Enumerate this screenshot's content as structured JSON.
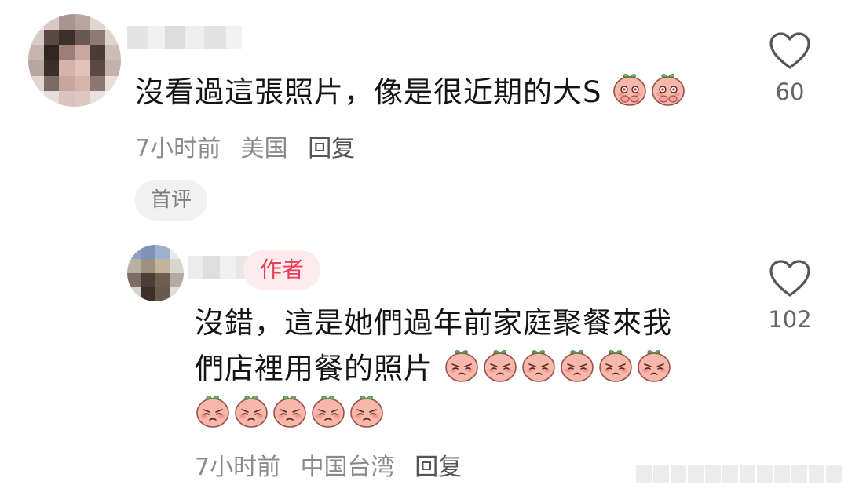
{
  "comments": [
    {
      "text": "沒看過這張照片，像是很近期的大S",
      "emojis": [
        "shy-peach-emoji",
        "shy-peach-emoji"
      ],
      "time": "7小时前",
      "location": "美国",
      "reply_label": "回复",
      "tag": "首评",
      "like_count": "60"
    },
    {
      "badge": "作者",
      "text_line1": "沒錯，這是她們過年前家庭聚餐來我",
      "text_line2": "們店裡用餐的照片",
      "emojis_line2": [
        "sad-peach-emoji",
        "sad-peach-emoji",
        "sad-peach-emoji",
        "sad-peach-emoji",
        "sad-peach-emoji",
        "sad-peach-emoji"
      ],
      "emojis_line3": [
        "sad-peach-emoji",
        "sad-peach-emoji",
        "sad-peach-emoji",
        "sad-peach-emoji",
        "sad-peach-emoji"
      ],
      "time": "7小时前",
      "location": "中国台湾",
      "reply_label": "回复",
      "like_count": "102"
    }
  ],
  "icons": {
    "like": "heart-outline-icon"
  },
  "colors": {
    "text": "#141414",
    "meta": "#8a8a8a",
    "badge_text": "#e6405a",
    "badge_bg": "#fdebee",
    "chip_bg": "#f1f1f1",
    "peach": "#f7b7aa"
  }
}
